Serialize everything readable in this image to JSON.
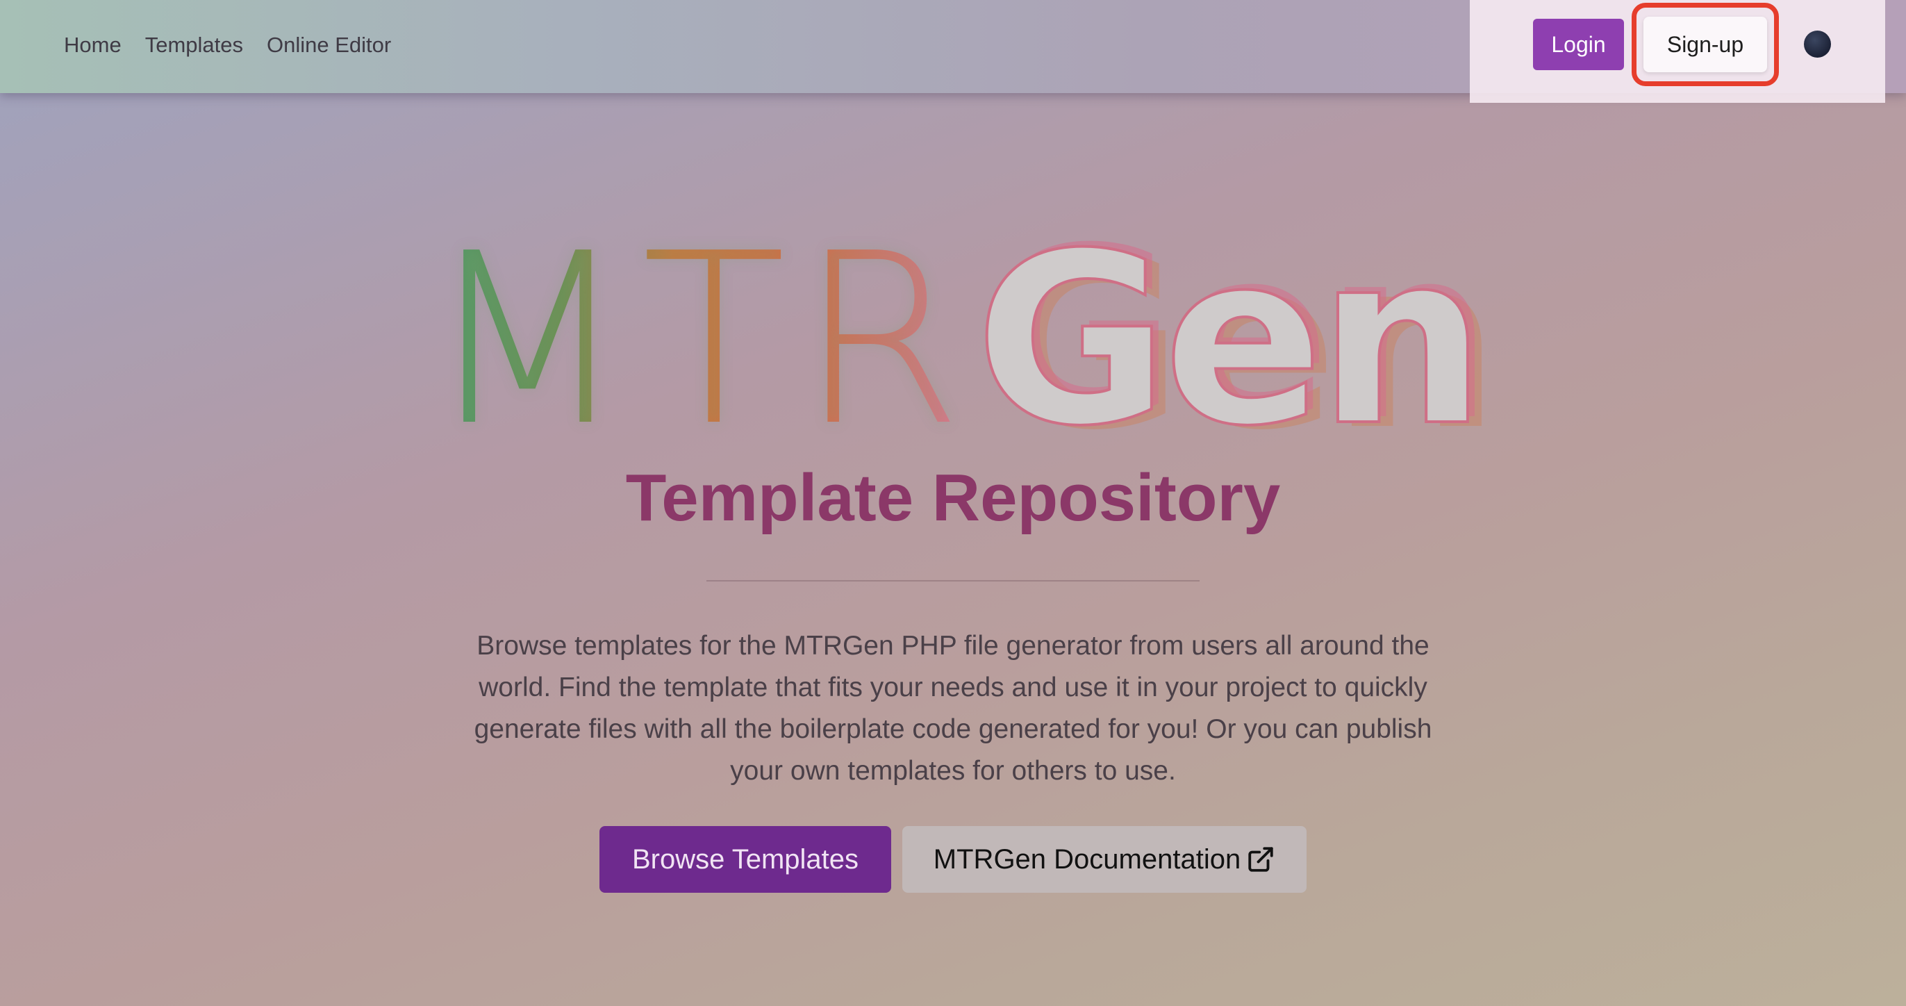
{
  "nav": {
    "links": [
      {
        "label": "Home"
      },
      {
        "label": "Templates"
      },
      {
        "label": "Online Editor"
      }
    ],
    "login_label": "Login",
    "signup_label": "Sign-up",
    "theme_toggle_icon": "theme-toggle-icon"
  },
  "hero": {
    "logo_light": "MTR",
    "logo_bold": "Gen",
    "subtitle": "Template Repository",
    "description": "Browse templates for the MTRGen PHP file generator from users all around the world. Find the template that fits your needs and use it in your project to quickly generate files with all the boilerplate code generated for you! Or you can publish your own templates for others to use.",
    "browse_label": "Browse Templates",
    "docs_label": "MTRGen Documentation",
    "docs_icon": "external-link-icon"
  },
  "colors": {
    "primary": "#8e3fb0",
    "browse_button": "#6e2a8e",
    "subtitle": "#8b3868",
    "highlight": "#e63d2c"
  }
}
